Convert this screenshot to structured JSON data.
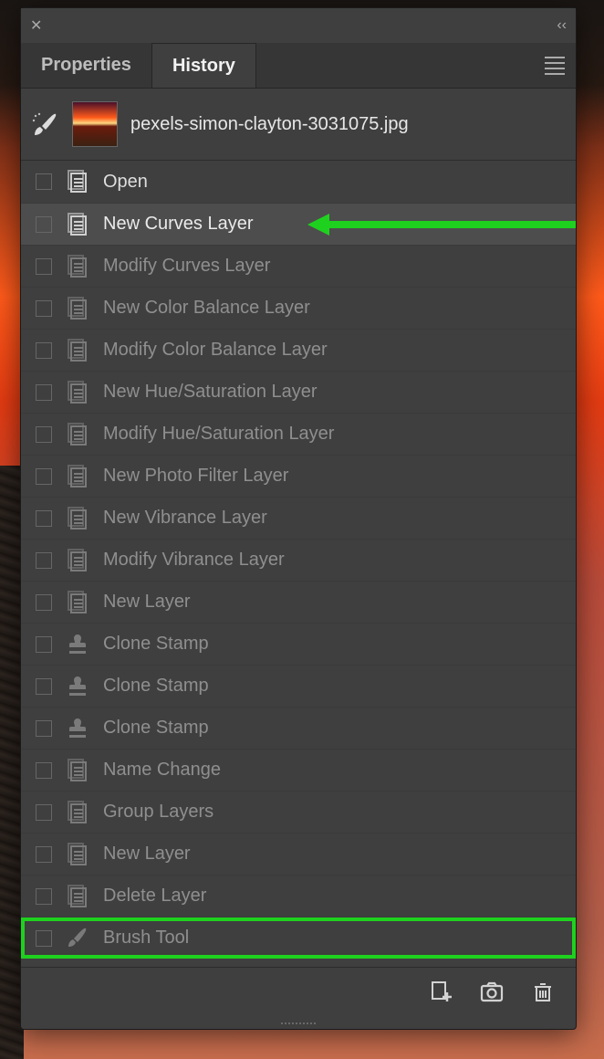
{
  "tabs": {
    "properties": "Properties",
    "history": "History"
  },
  "file": {
    "name": "pexels-simon-clayton-3031075.jpg"
  },
  "history": [
    {
      "label": "Open",
      "icon": "doc",
      "state": "pre"
    },
    {
      "label": "New Curves Layer",
      "icon": "doc",
      "state": "active"
    },
    {
      "label": "Modify Curves Layer",
      "icon": "doc",
      "state": "post"
    },
    {
      "label": "New Color Balance Layer",
      "icon": "doc",
      "state": "post"
    },
    {
      "label": "Modify Color Balance Layer",
      "icon": "doc",
      "state": "post"
    },
    {
      "label": "New Hue/Saturation Layer",
      "icon": "doc",
      "state": "post"
    },
    {
      "label": "Modify Hue/Saturation Layer",
      "icon": "doc",
      "state": "post"
    },
    {
      "label": "New Photo Filter Layer",
      "icon": "doc",
      "state": "post"
    },
    {
      "label": "New Vibrance Layer",
      "icon": "doc",
      "state": "post"
    },
    {
      "label": "Modify Vibrance Layer",
      "icon": "doc",
      "state": "post"
    },
    {
      "label": "New Layer",
      "icon": "doc",
      "state": "post"
    },
    {
      "label": "Clone Stamp",
      "icon": "stamp",
      "state": "post"
    },
    {
      "label": "Clone Stamp",
      "icon": "stamp",
      "state": "post"
    },
    {
      "label": "Clone Stamp",
      "icon": "stamp",
      "state": "post"
    },
    {
      "label": "Name Change",
      "icon": "doc",
      "state": "post"
    },
    {
      "label": "Group Layers",
      "icon": "doc",
      "state": "post"
    },
    {
      "label": "New Layer",
      "icon": "doc",
      "state": "post"
    },
    {
      "label": "Delete Layer",
      "icon": "doc",
      "state": "post"
    },
    {
      "label": "Brush Tool",
      "icon": "brush",
      "state": "post",
      "highlight": true
    }
  ],
  "annotation": {
    "arrow_target_index": 1
  },
  "icons": {
    "doc": "document-icon",
    "stamp": "stamp-icon",
    "brush": "brush-icon"
  }
}
